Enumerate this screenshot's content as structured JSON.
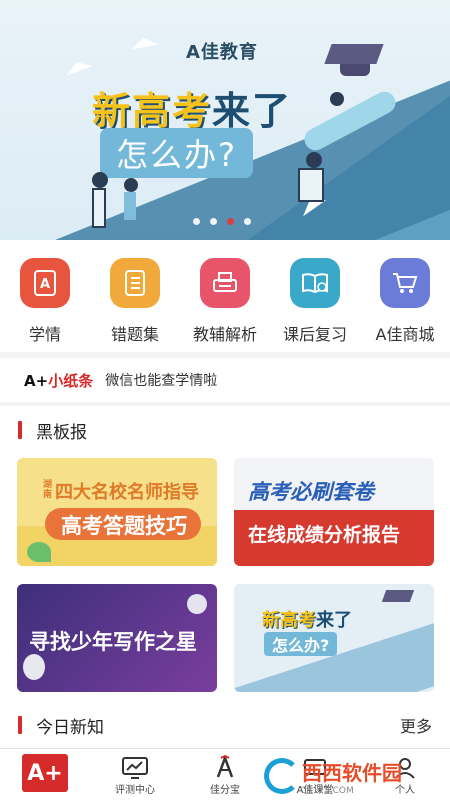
{
  "banner": {
    "brand": "A佳教育",
    "headline_yellow": "新高考",
    "headline_dark": "来了",
    "question": "怎么办?",
    "carousel_active_index": 2,
    "carousel_count": 4
  },
  "menu": [
    {
      "label": "学情",
      "icon": "report-icon",
      "color": "#e8553f",
      "glyph": "A"
    },
    {
      "label": "错题集",
      "icon": "notebook-icon",
      "color": "#f2a93b",
      "glyph": "☰"
    },
    {
      "label": "教辅解析",
      "icon": "printer-icon",
      "color": "#e8556a",
      "glyph": "▣"
    },
    {
      "label": "课后复习",
      "icon": "book-check-icon",
      "color": "#3aa8c9",
      "glyph": "✓"
    },
    {
      "label": "A佳商城",
      "icon": "cart-icon",
      "color": "#6b7bd8",
      "glyph": "🛒"
    }
  ],
  "notice": {
    "logo_black": "A+",
    "logo_red": "小纸条",
    "text": "微信也能查学情啦"
  },
  "blackboard": {
    "title": "黑板报",
    "cards": [
      {
        "small": "湖南",
        "line1": "四大名校名师指导",
        "line2": "高考答题技巧"
      },
      {
        "line1": "高考必刷套卷",
        "line2": "在线成绩分析报告"
      },
      {
        "line1": "寻找少年写作之星"
      },
      {
        "line1": "新高考",
        "line1b": "来了",
        "line2": "怎么办?"
      }
    ]
  },
  "today": {
    "title": "今日新知",
    "more": "更多"
  },
  "tabbar": [
    {
      "label": "",
      "logo": "A+"
    },
    {
      "label": "评测中心",
      "icon": "monitor-chart-icon"
    },
    {
      "label": "佳分宝",
      "icon": "a-badge-icon"
    },
    {
      "label": "A佳课堂",
      "icon": "classroom-icon"
    },
    {
      "label": "个人",
      "icon": "user-icon"
    }
  ],
  "watermark": {
    "text": "西西软件园",
    "url_text": "CR173.COM"
  }
}
